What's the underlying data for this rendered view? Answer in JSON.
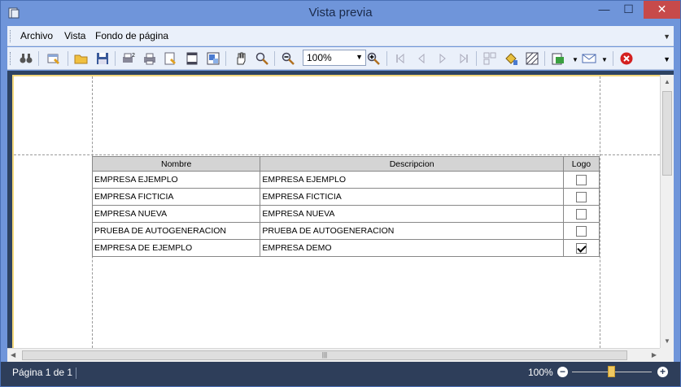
{
  "window": {
    "title": "Vista previa",
    "controls": {
      "minimize": "—",
      "maximize": "☐",
      "close": "✕"
    }
  },
  "menubar": {
    "items": [
      {
        "label": "Archivo"
      },
      {
        "label": "Vista"
      },
      {
        "label": "Fondo de página"
      }
    ]
  },
  "toolbar": {
    "zoom_value": "100%",
    "icons": [
      "find-icon",
      "parameters-icon",
      "open-icon",
      "save-icon",
      "print-setup-icon",
      "print-icon",
      "quick-print-icon",
      "page-setup-icon",
      "scale-icon",
      "hand-tool-icon",
      "magnifier-icon",
      "zoom-out-icon",
      "zoom-in-icon",
      "first-page-icon",
      "previous-page-icon",
      "next-page-icon",
      "last-page-icon",
      "multiple-pages-icon",
      "fill-background-icon",
      "watermark-icon",
      "export-icon",
      "send-email-icon",
      "close-preview-icon"
    ]
  },
  "report": {
    "columns": [
      "Nombre",
      "Descripcion",
      "Logo"
    ],
    "rows": [
      {
        "nombre": "EMPRESA EJEMPLO",
        "descripcion": "EMPRESA EJEMPLO",
        "logo": false
      },
      {
        "nombre": "EMPRESA FICTICIA",
        "descripcion": "EMPRESA FICTICIA",
        "logo": false
      },
      {
        "nombre": "EMPRESA NUEVA",
        "descripcion": "EMPRESA NUEVA",
        "logo": false
      },
      {
        "nombre": "PRUEBA DE AUTOGENERACION",
        "descripcion": "PRUEBA DE AUTOGENERACION",
        "logo": false
      },
      {
        "nombre": "EMPRESA DE EJEMPLO",
        "descripcion": "EMPRESA DEMO",
        "logo": true
      }
    ]
  },
  "statusbar": {
    "page_info": "Página 1 de 1",
    "zoom": "100%",
    "zoom_level_percent": 100
  },
  "colors": {
    "titlebar": "#6f95da",
    "close_button": "#c74a4a",
    "statusbar": "#2e3e5a",
    "viewer_background": "#2d4262",
    "page_margin_border": "#f3d77a"
  }
}
